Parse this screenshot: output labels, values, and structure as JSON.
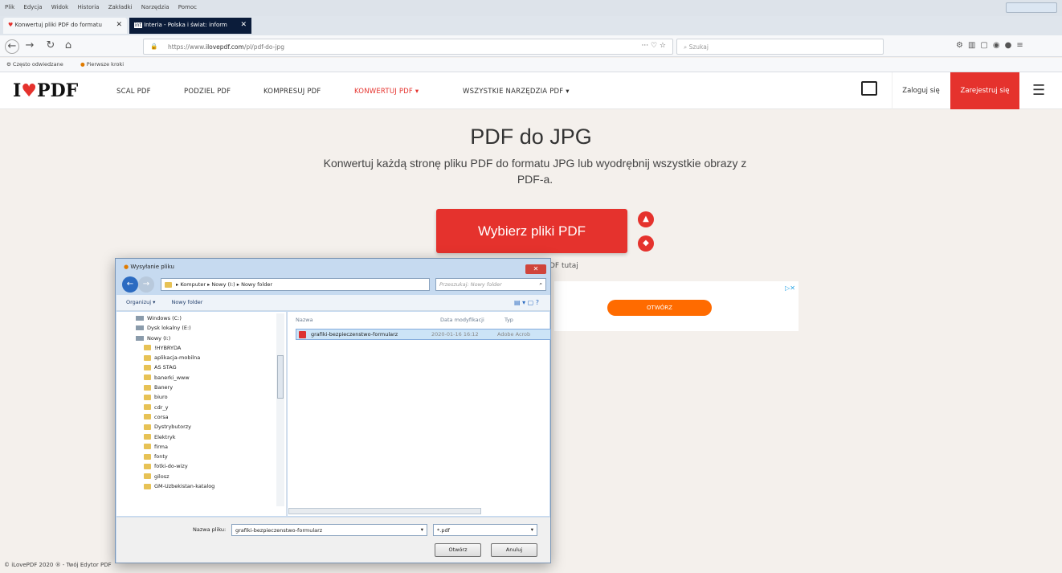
{
  "browser": {
    "menu": [
      "Plik",
      "Edycja",
      "Widok",
      "Historia",
      "Zakładki",
      "Narzędzia",
      "Pomoc"
    ],
    "tabs": [
      {
        "label": "Konwertuj pliki PDF do formatu"
      },
      {
        "label": "Interia - Polska i świat: inform"
      }
    ],
    "url_prefix": "https://www.",
    "url_domain": "ilovepdf.com",
    "url_path": "/pl/pdf-do-jpg",
    "search_placeholder": "Szukaj",
    "bookmarks": [
      "Często odwiedzane",
      "Pierwsze kroki"
    ]
  },
  "site": {
    "logo_left": "I",
    "logo_heart": "♥",
    "logo_right": "PDF",
    "nav": [
      "SCAL PDF",
      "PODZIEL PDF",
      "KOMPRESUJ PDF",
      "KONWERTUJ PDF ▾",
      "WSZYSTKIE NARZĘDZIA PDF ▾"
    ],
    "login": "Zaloguj się",
    "register": "Zarejestruj się",
    "title": "PDF do JPG",
    "subtitle": "Konwertuj każdą stronę pliku PDF do formatu JPG lub wyodrębnij wszystkie obrazy z PDF-a.",
    "choose_button": "Wybierz pliki PDF",
    "drop_text": "DF tutaj",
    "ad_button": "OTWÓRZ",
    "footer": "© iLovePDF 2020 ® - Twój Edytor PDF",
    "accent": "#e5322d"
  },
  "dialog": {
    "title": "Wysyłanie pliku",
    "path": "▸ Komputer ▸ Nowy (I:) ▸ Nowy folder",
    "search_placeholder": "Przeszukaj: Nowy folder",
    "toolbar": [
      "Organizuj ▾",
      "Nowy folder"
    ],
    "tree": [
      {
        "label": "Windows (C:)",
        "type": "drive"
      },
      {
        "label": "Dysk lokalny (E:)",
        "type": "drive"
      },
      {
        "label": "Nowy (I:)",
        "type": "drive"
      },
      {
        "label": "!HYBRYDA",
        "type": "folder"
      },
      {
        "label": "aplikacja-mobilna",
        "type": "folder"
      },
      {
        "label": "AS STAG",
        "type": "folder"
      },
      {
        "label": "banerki_www",
        "type": "folder"
      },
      {
        "label": "Banery",
        "type": "folder"
      },
      {
        "label": "biuro",
        "type": "folder"
      },
      {
        "label": "cdr_y",
        "type": "folder"
      },
      {
        "label": "corsa",
        "type": "folder"
      },
      {
        "label": "Dystrybutorzy",
        "type": "folder"
      },
      {
        "label": "Elektryk",
        "type": "folder"
      },
      {
        "label": "firma",
        "type": "folder"
      },
      {
        "label": "fonty",
        "type": "folder"
      },
      {
        "label": "fotki-do-wizy",
        "type": "folder"
      },
      {
        "label": "gilosz",
        "type": "folder"
      },
      {
        "label": "GM-Uzbekistan-katalog",
        "type": "folder"
      }
    ],
    "columns": [
      "Nazwa",
      "Data modyfikacji",
      "Typ"
    ],
    "file": {
      "name": "grafiki-bezpieczenstwo-formularz",
      "date": "2020-01-16 16:12",
      "type": "Adobe Acrob"
    },
    "filename_label": "Nazwa pliku:",
    "filename_value": "grafiki-bezpieczenstwo-formularz",
    "filetype": "*.pdf",
    "open": "Otwórz",
    "cancel": "Anuluj"
  }
}
